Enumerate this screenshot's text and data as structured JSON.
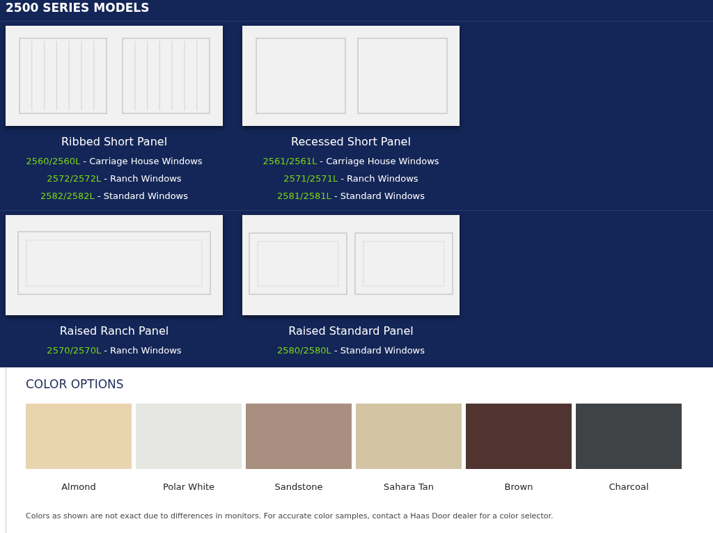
{
  "models_section": {
    "title": "2500 SERIES MODELS",
    "rows": [
      {
        "models": [
          {
            "kind": "ribbed",
            "name": "Ribbed Short Panel",
            "variants": [
              {
                "code": "2560/2560L",
                "description": "- Carriage House Windows"
              },
              {
                "code": "2572/2572L",
                "description": "- Ranch Windows"
              },
              {
                "code": "2582/2582L",
                "description": "- Standard Windows"
              }
            ]
          },
          {
            "kind": "recessed",
            "name": "Recessed Short Panel",
            "variants": [
              {
                "code": "2561/2561L",
                "description": "- Carriage House Windows"
              },
              {
                "code": "2571/2571L",
                "description": "- Ranch Windows"
              },
              {
                "code": "2581/2581L",
                "description": "- Standard Windows"
              }
            ]
          }
        ]
      },
      {
        "models": [
          {
            "kind": "raised-ranch",
            "name": "Raised Ranch Panel",
            "variants": [
              {
                "code": "2570/2570L",
                "description": "- Ranch Windows"
              }
            ]
          },
          {
            "kind": "raised-standard",
            "name": "Raised Standard Panel",
            "variants": [
              {
                "code": "2580/2580L",
                "description": "- Standard Windows"
              }
            ]
          }
        ]
      }
    ]
  },
  "color_options": {
    "title": "COLOR OPTIONS",
    "swatches": [
      {
        "name": "Almond",
        "color": "#e9d4b0"
      },
      {
        "name": "Polar White",
        "color": "#e6e6e3"
      },
      {
        "name": "Sandstone",
        "color": "#a88f80"
      },
      {
        "name": "Sahara Tan",
        "color": "#d3c4a4"
      },
      {
        "name": "Brown",
        "color": "#4f3430"
      },
      {
        "name": "Charcoal",
        "color": "#3f4346"
      }
    ],
    "note": "Colors as shown are not exact due to differences in monitors. For accurate color samples, contact a Haas Door dealer for a color selector."
  }
}
